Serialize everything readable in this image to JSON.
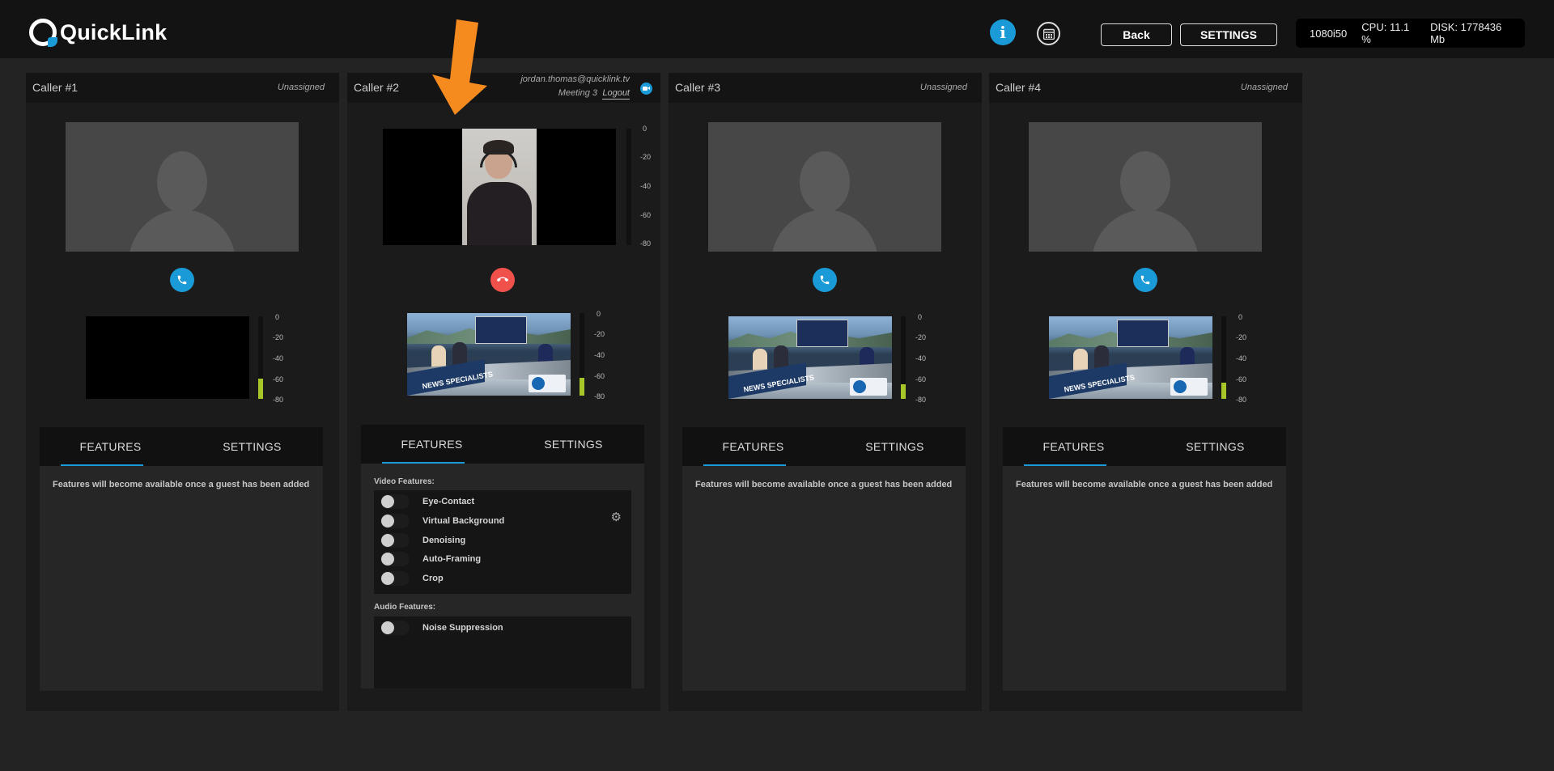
{
  "app": {
    "logo_text": "QuickLink"
  },
  "header": {
    "info_icon": "info-icon",
    "info_glyph": "i",
    "calendar_icon": "calendar-icon",
    "back_label": "Back",
    "settings_label": "SETTINGS",
    "status": {
      "format": "1080i50",
      "cpu": "CPU: 11.1 %",
      "disk": "DISK: 1778436 Mb"
    }
  },
  "colors": {
    "accent": "#1a9ad6",
    "hangup": "#f0524b",
    "meter": "#a7c628",
    "arrow": "#f58a1f"
  },
  "meter_labels": [
    "0",
    "-20",
    "-40",
    "-60",
    "-80"
  ],
  "tabs": {
    "features": "FEATURES",
    "settings": "SETTINGS"
  },
  "empty_message": "Features will become available once a guest has been added",
  "callers": [
    {
      "name": "Caller #1",
      "status": "Unassigned",
      "call_icon": "phone-icon",
      "audio_level": 0.25
    },
    {
      "name": "Caller #2",
      "user_email": "jordan.thomas@quicklink.tv",
      "meeting": "Meeting 3",
      "logout": "Logout",
      "call_icon": "hang-up-icon",
      "audio_level": 0.22,
      "video_features_label": "Video Features:",
      "video_features": [
        "Eye-Contact",
        "Virtual Background",
        "Denoising",
        "Auto-Framing",
        "Crop"
      ],
      "audio_features_label": "Audio Features:",
      "audio_features": [
        "Noise Suppression"
      ],
      "program_banner": "NEWS SPECIALISTS"
    },
    {
      "name": "Caller #3",
      "status": "Unassigned",
      "call_icon": "phone-icon",
      "audio_level": 0.18,
      "program_banner": "NEWS SPECIALISTS"
    },
    {
      "name": "Caller #4",
      "status": "Unassigned",
      "call_icon": "phone-icon",
      "audio_level": 0.2,
      "program_banner": "NEWS SPECIALISTS"
    }
  ]
}
